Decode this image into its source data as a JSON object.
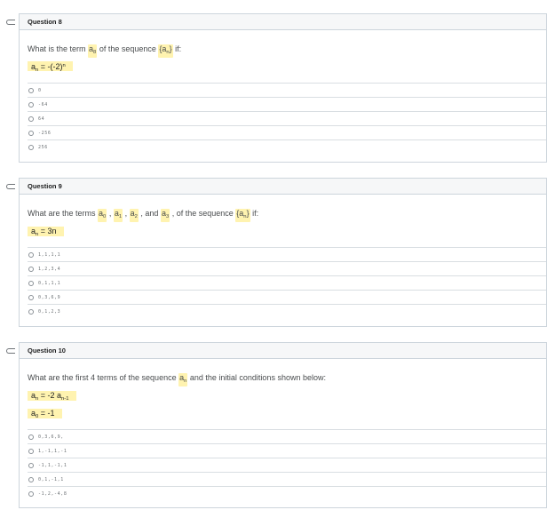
{
  "questions": [
    {
      "header": "Question 8",
      "prompt": {
        "p1": "What is the term ",
        "hl_var": "a",
        "hl_sub": "8",
        "p2": " of the sequence ",
        "seq": "{a",
        "seq_sub": "n",
        "seq_end": "}",
        "p3": " if:"
      },
      "formulas": [
        {
          "a": "a",
          "a_sub": "n",
          "eq": " = -(-2)",
          "sup": "n"
        }
      ],
      "options": [
        "0",
        "-64",
        "64",
        "-256",
        "256"
      ]
    },
    {
      "header": "Question 9",
      "prompt": {
        "p1": "What are the terms ",
        "t0": "a",
        "t0s": "0",
        "c1": " , ",
        "t1": "a",
        "t1s": "1",
        "c2": " , ",
        "t2": "a",
        "t2s": "2",
        "c3": " , and ",
        "t3": "a",
        "t3s": "3",
        "c4": " ,  of the sequence ",
        "seq": "{a",
        "seq_sub": "n",
        "seq_end": "}",
        "p3": " if:"
      },
      "formulas": [
        {
          "a": "a",
          "a_sub": "n",
          "eq": " = 3n"
        }
      ],
      "options": [
        "1,1,1,1",
        "1,2,3,4",
        "0,1,1,1",
        "0,3,6,9",
        "0,1,2,3"
      ]
    },
    {
      "header": "Question 10",
      "prompt": {
        "p1": "What are the first 4 terms of the sequence ",
        "var": "a",
        "var_sub": "n",
        "p2": " and the initial conditions shown below:"
      },
      "formulas": [
        {
          "a": "a",
          "a_sub": "n",
          "eq": " = -2 a",
          "sub2": "n-1"
        },
        {
          "a": "a",
          "a_sub": "0",
          "eq": " = -1"
        }
      ],
      "options": [
        "0,3,6,9,",
        "1,-1,1,-1",
        "-1,1,-1,1",
        "0,1,-1,1",
        "-1,2,-4,8"
      ]
    }
  ]
}
